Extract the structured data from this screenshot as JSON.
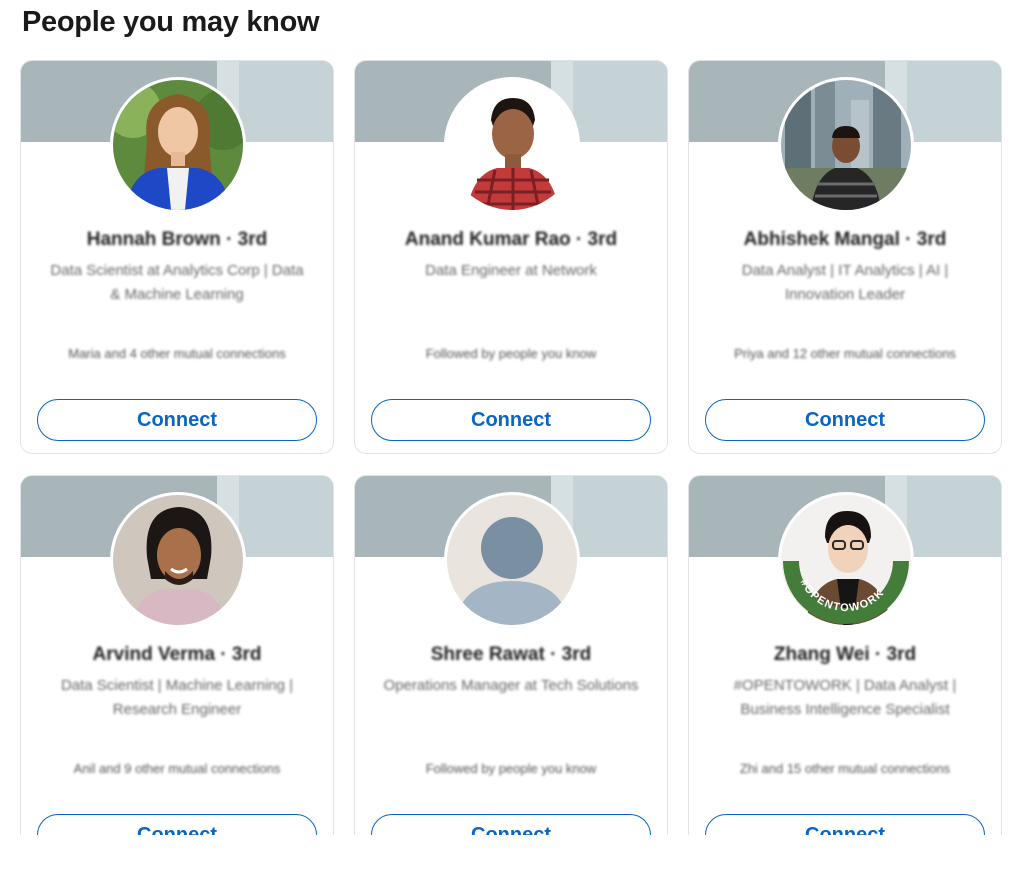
{
  "section": {
    "title": "People you may know"
  },
  "people": [
    {
      "name": "Hannah Brown · 3rd",
      "headline": "Data Scientist at Analytics Corp | Data & Machine Learning",
      "mutual": "Maria and 4 other mutual connections",
      "connect_label": "Connect"
    },
    {
      "name": "Anand Kumar Rao · 3rd",
      "headline": "Data Engineer at Network",
      "mutual": "Followed by people you know",
      "connect_label": "Connect"
    },
    {
      "name": "Abhishek Mangal · 3rd",
      "headline": "Data Analyst | IT Analytics | AI | Innovation Leader",
      "mutual": "Priya and 12 other mutual connections",
      "connect_label": "Connect"
    },
    {
      "name": "Arvind Verma · 3rd",
      "headline": "Data Scientist | Machine Learning | Research Engineer",
      "mutual": "Anil and 9 other mutual connections",
      "connect_label": "Connect"
    },
    {
      "name": "Shree Rawat · 3rd",
      "headline": "Operations Manager at Tech Solutions",
      "mutual": "Followed by people you know",
      "connect_label": "Connect"
    },
    {
      "name": "Zhang Wei · 3rd",
      "headline": "#OPENTOWORK | Data Analyst | Business Intelligence Specialist",
      "mutual": "Zhi and 15 other mutual connections",
      "connect_label": "Connect"
    }
  ],
  "badges": {
    "open_to_work": "#OPENTOWORK"
  },
  "icons": {
    "default_avatar": "person-silhouette-icon"
  },
  "colors": {
    "accent": "#0a66c2",
    "banner": "#a8b6ba",
    "open_to_work_ring": "#447d3a"
  }
}
